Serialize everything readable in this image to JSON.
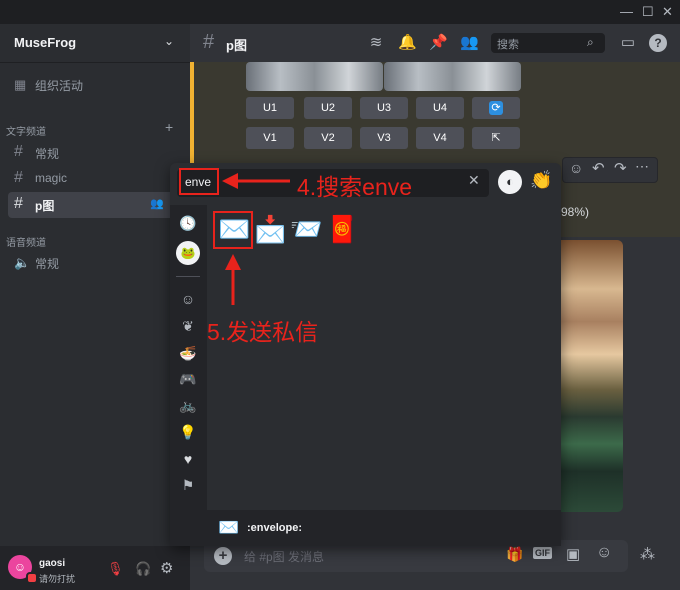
{
  "window": {
    "minimize": "—",
    "maximize": "☐",
    "close": "✕"
  },
  "server": {
    "name": "MuseFrog",
    "events_label": "组织活动"
  },
  "categories": {
    "text": "文字频道",
    "voice": "语音频道"
  },
  "channels": {
    "c1": "常规",
    "c2": "magic",
    "c3": "p图",
    "v1": "常规"
  },
  "header": {
    "channel": "p图",
    "search_placeholder": "搜索"
  },
  "buttons": {
    "u1": "U1",
    "u2": "U2",
    "u3": "U3",
    "u4": "U4",
    "v1": "V1",
    "v2": "V2",
    "v3": "V3",
    "v4": "V4"
  },
  "message": {
    "progress": "98%)"
  },
  "picker": {
    "search_value": "enve",
    "selected_name": ":envelope:",
    "emojis": [
      "✉️",
      "📩",
      "📨",
      "🧧"
    ]
  },
  "annotations": {
    "step4": "4.搜索enve",
    "step5": "5.发送私信"
  },
  "user": {
    "name": "gaosi",
    "status": "请勿打扰"
  },
  "composer": {
    "placeholder": "给 #p图 发消息",
    "gif": "GIF"
  },
  "colors": {
    "accent": "#5865f2",
    "annotation": "#e8231c",
    "highlight": "#f0b232"
  }
}
